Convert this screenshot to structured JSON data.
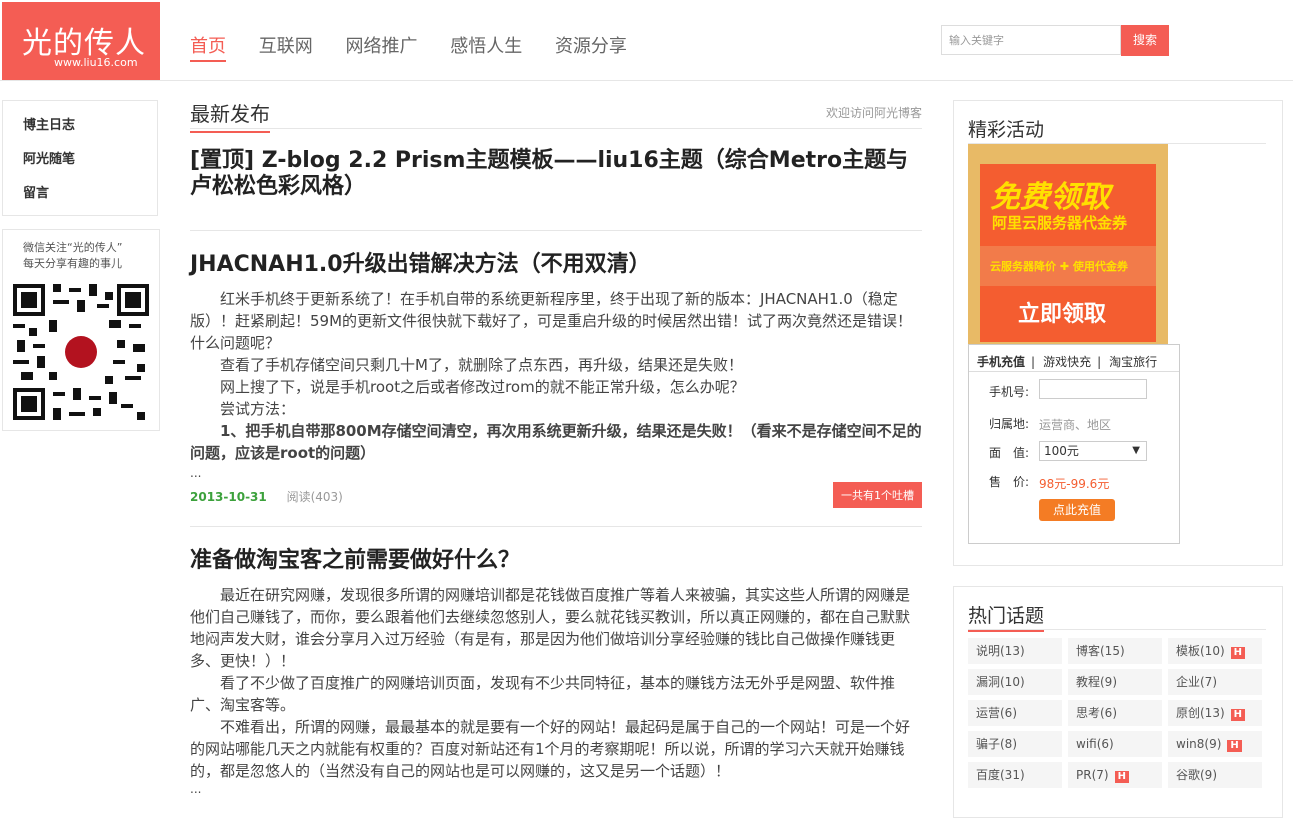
{
  "header": {
    "logo_text": "光的传人",
    "logo_url": "www.liu16.com",
    "nav": [
      "首页",
      "互联网",
      "网络推广",
      "感悟人生",
      "资源分享"
    ],
    "search_placeholder": "输入关键字",
    "search_btn": "搜索"
  },
  "left": {
    "menu": [
      "博主日志",
      "阿光随笔",
      "留言"
    ],
    "wechat_line1": "微信关注“光的传人”",
    "wechat_line2": "每天分享有趣的事儿"
  },
  "main": {
    "section_title": "最新发布",
    "welcome": "欢迎访问阿光博客",
    "articles": [
      {
        "title": "[置顶] Z-blog 2.2 Prism主题模板——liu16主题（综合Metro主题与卢松松色彩风格）"
      },
      {
        "title": "JHACNAH1.0升级出错解决方法（不用双清）",
        "p1": "红米手机终于更新系统了！在手机自带的系统更新程序里，终于出现了新的版本：JHACNAH1.0（稳定版）！赶紧刷起！59M的更新文件很快就下载好了，可是重启升级的时候居然出错！试了两次竟然还是错误！什么问题呢？",
        "p2": "查看了手机存储空间只剩几十M了，就删除了点东西，再升级，结果还是失败！",
        "p3": "网上搜了下，说是手机root之后或者修改过rom的就不能正常升级，怎么办呢？",
        "p4": "尝试方法：",
        "p5": "1、把手机自带那800M存储空间清空，再次用系统更新升级，结果还是失败！（看来不是存储空间不足的问题，应该是root的问题）",
        "more": "...",
        "date": "2013-10-31",
        "views": "阅读(403)",
        "comments": "一共有1个吐槽"
      },
      {
        "title": "准备做淘宝客之前需要做好什么？",
        "p1": "最近在研究网赚，发现很多所谓的网赚培训都是花钱做百度推广等着人来被骗，其实这些人所谓的网赚是他们自己赚钱了，而你，要么跟着他们去继续忽悠别人，要么就花钱买教训，所以真正网赚的，都在自己默默地闷声发大财，谁会分享月入过万经验（有是有，那是因为他们做培训分享经验赚的钱比自己做操作赚钱更多、更快！）！",
        "p2": "看了不少做了百度推广的网赚培训页面，发现有不少共同特征，基本的赚钱方法无外乎是网盟、软件推广、淘宝客等。",
        "p3": "不难看出，所谓的网赚，最最基本的就是要有一个好的网站！最起码是属于自己的一个网站！可是一个好的网站哪能几天之内就能有权重的？百度对新站还有1个月的考察期呢！所以说，所谓的学习六天就开始赚钱的，都是忽悠人的（当然没有自己的网站也是可以网赚的，这又是另一个话题）！",
        "more": "..."
      }
    ]
  },
  "activity": {
    "title": "精彩活动",
    "ad_line1": "免费领取",
    "ad_line2": "阿里云服务器代金券",
    "ad_line3": "云服务器降价 ✚ 使用代金券",
    "ad_cta": "立即领取",
    "tabs": [
      "手机充值",
      "游戏快充",
      "淘宝旅行"
    ],
    "phone_label": "手机号:",
    "area_label": "归属地:",
    "area_hint": "运营商、地区",
    "value_label": "面　值:",
    "value_selected": "100元",
    "price_label": "售　价:",
    "price_value": "98元-99.6元",
    "charge_btn": "点此充值"
  },
  "topics": {
    "title": "热门话题",
    "hot_badge": "H",
    "items": [
      {
        "label": "说明(13)",
        "hot": false
      },
      {
        "label": "博客(15)",
        "hot": false
      },
      {
        "label": "模板(10)",
        "hot": true
      },
      {
        "label": "漏洞(10)",
        "hot": false
      },
      {
        "label": "教程(9)",
        "hot": false
      },
      {
        "label": "企业(7)",
        "hot": false
      },
      {
        "label": "运营(6)",
        "hot": false
      },
      {
        "label": "思考(6)",
        "hot": false
      },
      {
        "label": "原创(13)",
        "hot": true
      },
      {
        "label": "骗子(8)",
        "hot": false
      },
      {
        "label": "wifi(6)",
        "hot": false
      },
      {
        "label": "win8(9)",
        "hot": true
      },
      {
        "label": "百度(31)",
        "hot": false
      },
      {
        "label": "PR(7)",
        "hot": true
      },
      {
        "label": "谷歌(9)",
        "hot": false
      }
    ]
  }
}
